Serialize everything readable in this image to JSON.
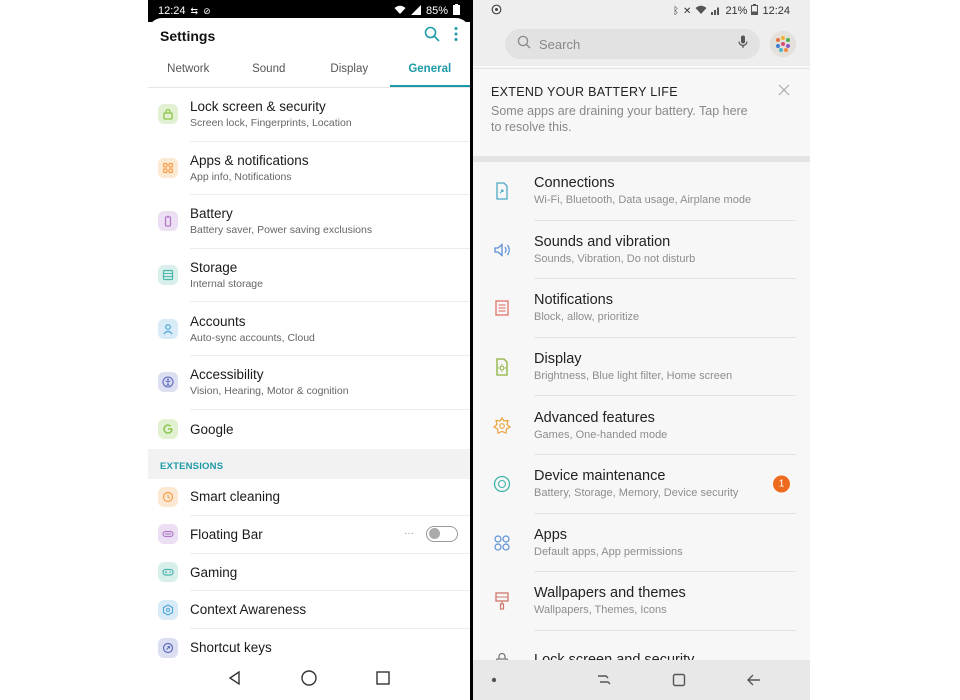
{
  "left": {
    "status": {
      "time": "12:24",
      "battery": "85%"
    },
    "title": "Settings",
    "tabs": [
      {
        "label": "Network"
      },
      {
        "label": "Sound"
      },
      {
        "label": "Display"
      },
      {
        "label": "General"
      }
    ],
    "items": [
      {
        "title": "Lock screen & security",
        "sub": "Screen lock, Fingerprints, Location",
        "color": "#8bc34a",
        "icon": "lock-icon"
      },
      {
        "title": "Apps & notifications",
        "sub": "App info, Notifications",
        "color": "#f5a04b",
        "icon": "apps-grid-icon"
      },
      {
        "title": "Battery",
        "sub": "Battery saver, Power saving exclusions",
        "color": "#b07cc6",
        "icon": "battery-icon"
      },
      {
        "title": "Storage",
        "sub": "Internal storage",
        "color": "#4db6ac",
        "icon": "storage-icon"
      },
      {
        "title": "Accounts",
        "sub": "Auto-sync accounts, Cloud",
        "color": "#4fa8d8",
        "icon": "person-icon"
      },
      {
        "title": "Accessibility",
        "sub": "Vision, Hearing, Motor & cognition",
        "color": "#5c6bc0",
        "icon": "accessibility-icon"
      },
      {
        "title": "Google",
        "color": "#8bc34a",
        "icon": "google-icon"
      }
    ],
    "extensions_label": "EXTENSIONS",
    "ext_items": [
      {
        "title": "Smart cleaning",
        "color": "#f5a04b",
        "icon": "clock-icon"
      },
      {
        "title": "Floating Bar",
        "color": "#b07cc6",
        "icon": "floating-bar-icon"
      },
      {
        "title": "Gaming",
        "color": "#4db6ac",
        "icon": "gamepad-icon"
      },
      {
        "title": "Context Awareness",
        "color": "#4fa8d8",
        "icon": "context-icon"
      },
      {
        "title": "Shortcut keys",
        "color": "#5c6bc0",
        "icon": "shortcut-icon"
      }
    ]
  },
  "right": {
    "status": {
      "battery": "21%",
      "time": "12:24"
    },
    "search_placeholder": "Search",
    "card": {
      "heading": "EXTEND YOUR BATTERY LIFE",
      "body": "Some apps are draining your battery. Tap here to resolve this."
    },
    "items": [
      {
        "title": "Connections",
        "sub": "Wi-Fi, Bluetooth, Data usage, Airplane mode",
        "color": "#4aa8c4",
        "icon": "connections-icon"
      },
      {
        "title": "Sounds and vibration",
        "sub": "Sounds, Vibration, Do not disturb",
        "color": "#5a8fd6",
        "icon": "speaker-icon"
      },
      {
        "title": "Notifications",
        "sub": "Block, allow, prioritize",
        "color": "#e0736b",
        "icon": "notifications-icon"
      },
      {
        "title": "Display",
        "sub": "Brightness, Blue light filter, Home screen",
        "color": "#8bb33a",
        "icon": "display-icon"
      },
      {
        "title": "Advanced features",
        "sub": "Games, One-handed mode",
        "color": "#e8a33a",
        "icon": "advanced-gear-icon"
      },
      {
        "title": "Device maintenance",
        "sub": "Battery, Storage, Memory, Device security",
        "color": "#3fb3a8",
        "icon": "maintenance-icon",
        "badge": "1"
      },
      {
        "title": "Apps",
        "sub": "Default apps, App permissions",
        "color": "#5a8fd6",
        "icon": "apps-icon"
      },
      {
        "title": "Wallpapers and themes",
        "sub": "Wallpapers, Themes, Icons",
        "color": "#d0776a",
        "icon": "brush-icon"
      },
      {
        "title": "Lock screen and security",
        "color": "#7a7a7a",
        "icon": "lock-icon"
      }
    ]
  }
}
